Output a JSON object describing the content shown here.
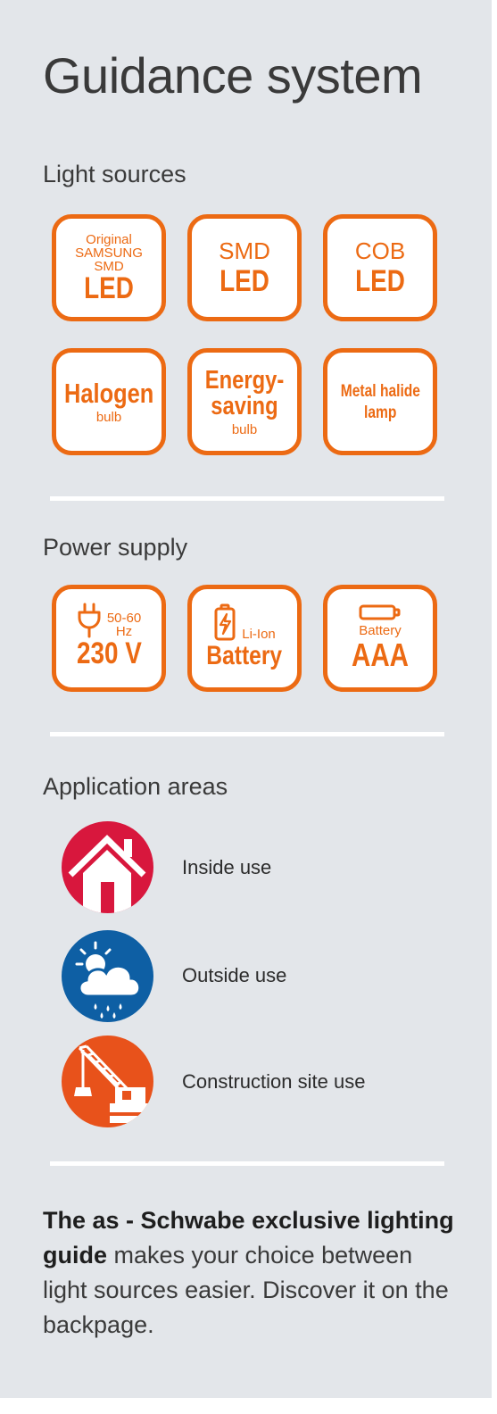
{
  "title": "Guidance system",
  "colors": {
    "accent": "#ec6a13",
    "panel": "#e3e6ea",
    "inside": "#d8173d",
    "outside": "#0e5fa4",
    "construction": "#e8521b"
  },
  "light_sources": {
    "heading": "Light sources",
    "tiles": [
      {
        "top": "Original",
        "top2": "SAMSUNG",
        "top3": "SMD",
        "main": "LED"
      },
      {
        "top": "SMD",
        "main": "LED"
      },
      {
        "top": "COB",
        "main": "LED"
      },
      {
        "main": "Halogen",
        "sub": "bulb"
      },
      {
        "main": "Energy-",
        "main2": "saving",
        "sub": "bulb"
      },
      {
        "main": "Metal halide",
        "main2": "lamp"
      }
    ]
  },
  "power_supply": {
    "heading": "Power supply",
    "tiles": [
      {
        "icon": "plug-icon",
        "sub": "50-60",
        "sub2": "Hz",
        "main": "230 V"
      },
      {
        "icon": "battery-charging-icon",
        "sub": "Li-Ion",
        "main": "Battery"
      },
      {
        "icon": "battery-icon",
        "sub": "Battery",
        "main": "AAA"
      }
    ]
  },
  "application_areas": {
    "heading": "Application areas",
    "items": [
      {
        "icon": "house-icon",
        "label": "Inside use"
      },
      {
        "icon": "weather-icon",
        "label": "Outside use"
      },
      {
        "icon": "crane-icon",
        "label": "Construction site use"
      }
    ]
  },
  "note": {
    "bold": "The as - Schwabe exclusive lighting guide",
    "rest": " makes your choice between light sources easier. Discover it on the backpage."
  }
}
